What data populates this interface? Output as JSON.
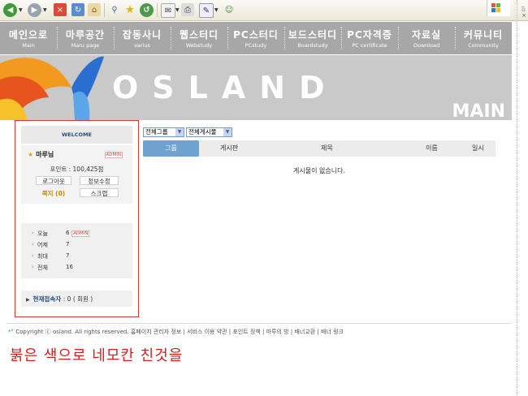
{
  "nav": {
    "items": [
      {
        "ko": "메인으로",
        "en": "Main"
      },
      {
        "ko": "마루공간",
        "en": "Maru page"
      },
      {
        "ko": "잡동사니",
        "en": "varius"
      },
      {
        "ko": "웹스터디",
        "en": "Webstudy"
      },
      {
        "ko": "PC스터디",
        "en": "PCstudy"
      },
      {
        "ko": "보드스터디",
        "en": "Boardstudy"
      },
      {
        "ko": "PC자격증",
        "en": "PC certificate"
      },
      {
        "ko": "자료실",
        "en": "Download"
      },
      {
        "ko": "커뮤니티",
        "en": "Community"
      }
    ]
  },
  "banner": {
    "title": "OSLAND",
    "subtitle": "MAIN"
  },
  "sidebar": {
    "welcome": "WELCOME",
    "user": {
      "name": "마루님",
      "badge": "ADMIN",
      "point": "포인트 : 100,425점"
    },
    "buttons": {
      "logout": "로그아웃",
      "edit_info": "정보수정",
      "memo": "쪽지 (0)",
      "scrap": "스크랩"
    },
    "stats": [
      {
        "label": "오늘",
        "value": "6",
        "badge": "ADMIN"
      },
      {
        "label": "어제",
        "value": "7"
      },
      {
        "label": "최대",
        "value": "7"
      },
      {
        "label": "전체",
        "value": "16"
      }
    ],
    "online_label": "현재접속자",
    "online_value": ": 0 ( 회원 )"
  },
  "board": {
    "group_select": "전체그룹",
    "board_select": "전체게시물",
    "columns": [
      "그룹",
      "게시판",
      "제목",
      "이름",
      "일시"
    ],
    "empty_message": "게시물이 없습니다."
  },
  "footer": {
    "copyright": "Copyright ⓒ osland. All rights reserved.",
    "links": "홈페이지 관리자 정보 | 서비스 이용 약관 | 포인트 정책 | 마루의 방 | 배너교환 | 배너 링크"
  },
  "annotation": "붉은 색으로 네모칸 친것을",
  "colors": {
    "nav_bg": "#a7a7a7",
    "banner_bg": "#c9c9c9",
    "highlight_box": "#d23a3a",
    "group_header": "#6ea3cf",
    "annotation": "#d41f1f"
  }
}
